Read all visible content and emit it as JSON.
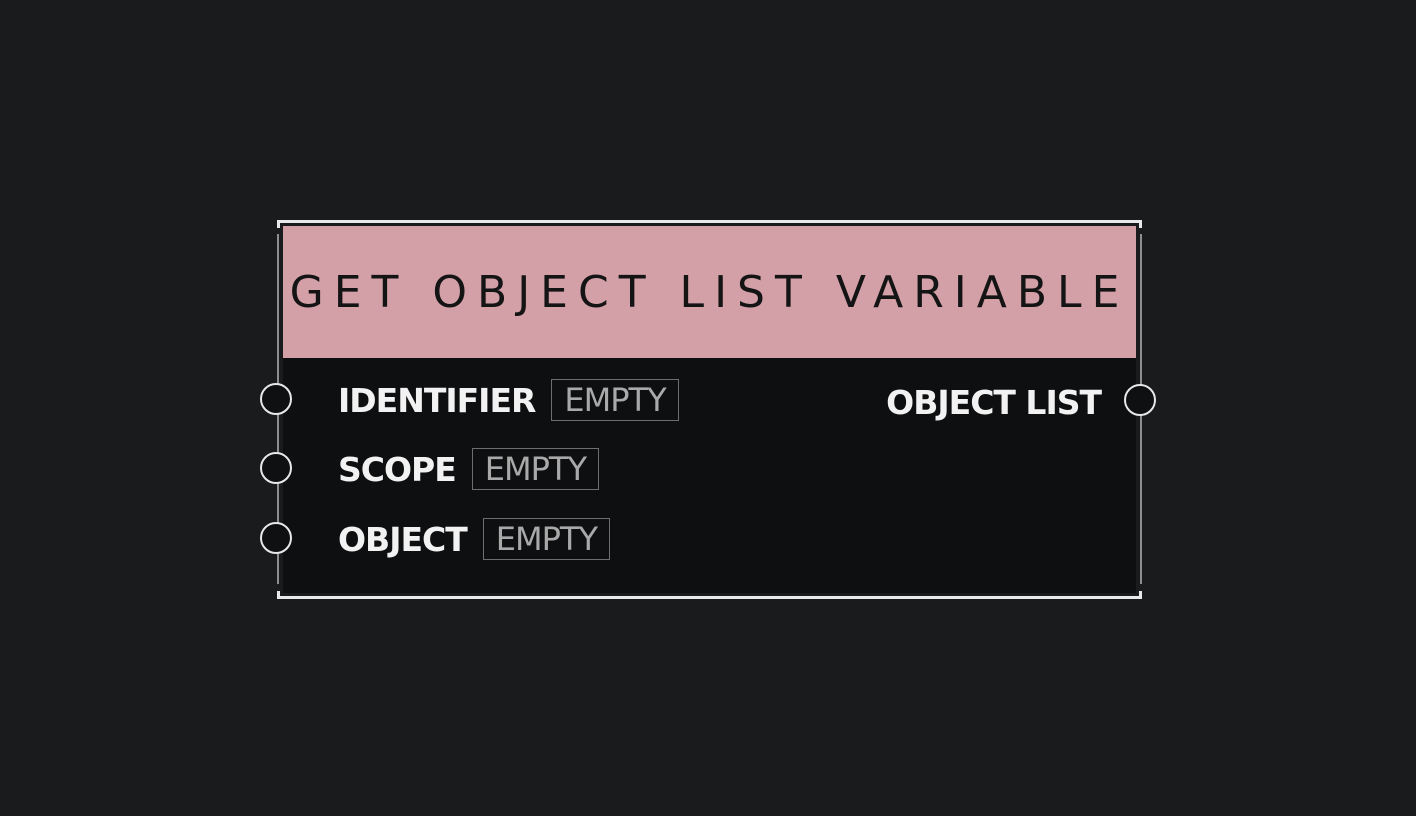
{
  "node": {
    "title": "GET OBJECT LIST VARIABLE",
    "header_color": "#d3a0a8",
    "inputs": [
      {
        "label": "IDENTIFIER",
        "value": "EMPTY"
      },
      {
        "label": "SCOPE",
        "value": "EMPTY"
      },
      {
        "label": "OBJECT",
        "value": "EMPTY"
      }
    ],
    "outputs": [
      {
        "label": "OBJECT LIST"
      }
    ]
  }
}
